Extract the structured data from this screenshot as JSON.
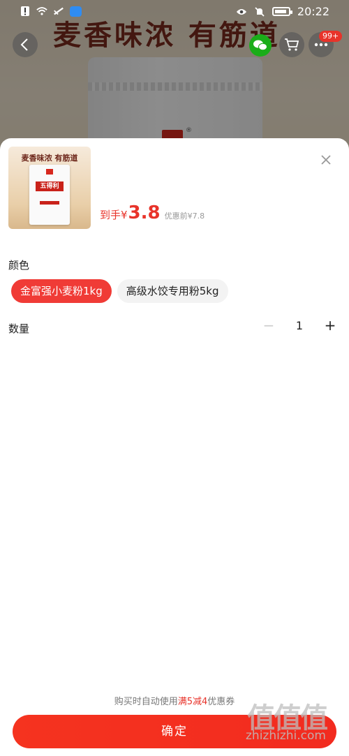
{
  "status_bar": {
    "time": "20:22",
    "icons": [
      "alert-icon",
      "wifi-icon",
      "signal-icon",
      "app-icon",
      "eye-icon",
      "mute-bell-icon",
      "battery-icon"
    ]
  },
  "background": {
    "headline": "麦香味浓 有筋道",
    "cart_badge": "99+"
  },
  "product": {
    "thumb_caption": "麦香味浓 有筋道",
    "thumb_brand": "五得利",
    "price_prefix": "到手¥",
    "price": "3.8",
    "original_price": "优惠前¥7.8"
  },
  "spec": {
    "color_title": "颜色",
    "options": [
      {
        "label": "金富强小麦粉1kg",
        "selected": true
      },
      {
        "label": "高级水饺专用粉5kg",
        "selected": false
      }
    ],
    "quantity_title": "数量",
    "quantity": "1",
    "minus": "−",
    "plus": "+"
  },
  "footer": {
    "coupon_prefix": "购买时自动使用",
    "coupon_highlight": "满5减4",
    "coupon_suffix": "优惠券",
    "confirm_label": "确定"
  },
  "watermark": {
    "logo": "值值值",
    "text": "zhizhizhi.com"
  },
  "colors": {
    "accent": "#f03b36",
    "price": "#e8332a",
    "wechat": "#1aad19"
  }
}
